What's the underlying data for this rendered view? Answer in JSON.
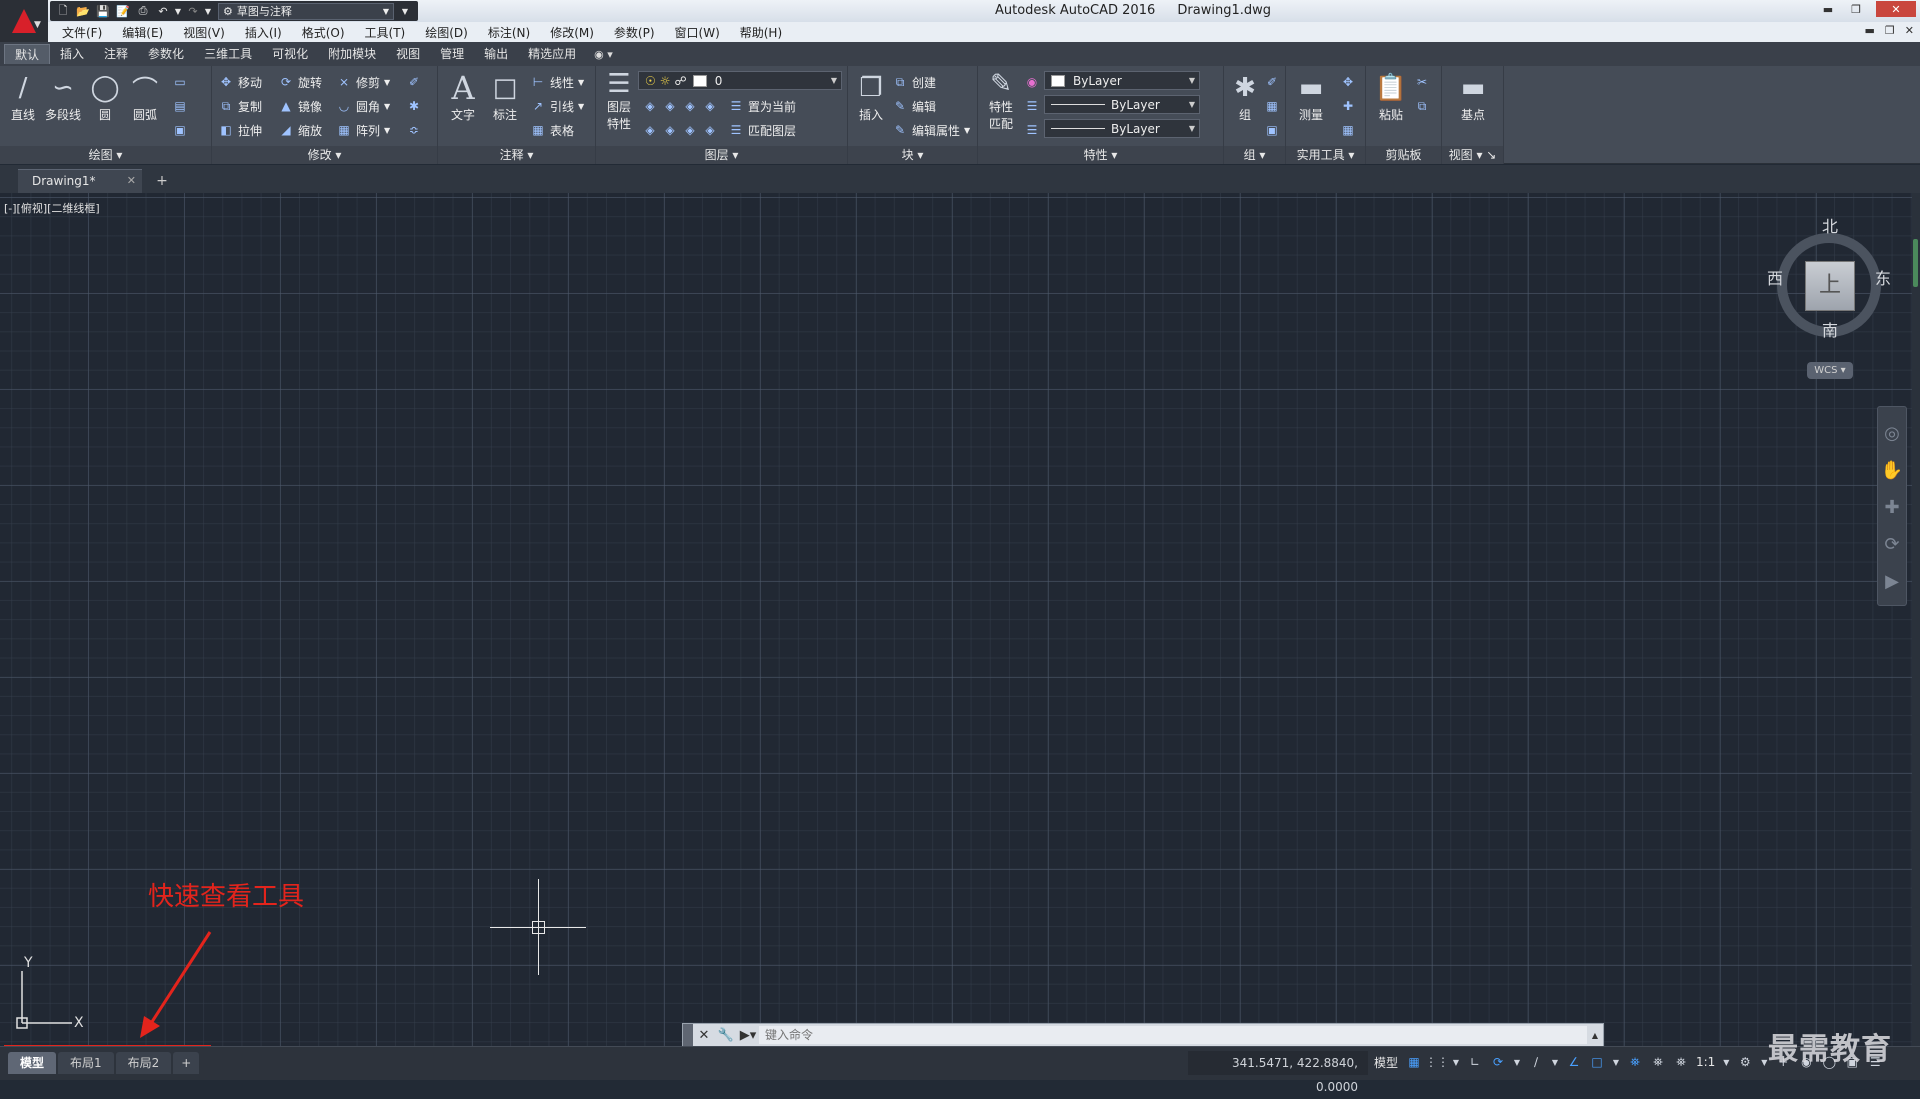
{
  "window": {
    "app_title": "Autodesk AutoCAD 2016",
    "file_title": "Drawing1.dwg"
  },
  "qat": {
    "workspace": "草图与注释"
  },
  "menu": [
    "文件(F)",
    "编辑(E)",
    "视图(V)",
    "插入(I)",
    "格式(O)",
    "工具(T)",
    "绘图(D)",
    "标注(N)",
    "修改(M)",
    "参数(P)",
    "窗口(W)",
    "帮助(H)"
  ],
  "ribbon_tabs": [
    "默认",
    "插入",
    "注释",
    "参数化",
    "三维工具",
    "可视化",
    "附加模块",
    "视图",
    "管理",
    "输出",
    "精选应用"
  ],
  "ribbon": {
    "draw": {
      "title": "绘图",
      "line": "直线",
      "polyline": "多段线",
      "circle": "圆",
      "arc": "圆弧"
    },
    "modify": {
      "title": "修改",
      "move": "移动",
      "rotate": "旋转",
      "trim": "修剪",
      "copy": "复制",
      "mirror": "镜像",
      "fillet": "圆角",
      "stretch": "拉伸",
      "scale": "缩放",
      "array": "阵列"
    },
    "annotation": {
      "title": "注释",
      "text": "文字",
      "dimension": "标注",
      "linear": "线性",
      "leader": "引线",
      "table": "表格"
    },
    "layers": {
      "title": "图层",
      "layer_props_1": "图层",
      "layer_props_2": "特性",
      "current_layer": "0",
      "set_current": "置为当前",
      "match_layer": "匹配图层"
    },
    "block": {
      "title": "块",
      "insert": "插入",
      "create": "创建",
      "edit": "编辑",
      "edit_attr": "编辑属性"
    },
    "properties": {
      "title": "特性",
      "match_1": "特性",
      "match_2": "匹配",
      "color": "ByLayer",
      "linetype": "ByLayer",
      "lineweight": "ByLayer"
    },
    "groups": {
      "title": "组",
      "group": "组"
    },
    "utilities": {
      "title": "实用工具",
      "measure": "测量"
    },
    "clipboard": {
      "title": "剪贴板",
      "paste": "粘贴"
    },
    "view": {
      "title": "视图",
      "base": "基点"
    }
  },
  "file_tab": {
    "name": "Drawing1*"
  },
  "viewport_label": "[-][俯视][二维线框]",
  "viewcube": {
    "north": "北",
    "south": "南",
    "east": "东",
    "west": "西",
    "top": "上",
    "wcs": "WCS"
  },
  "ucs": {
    "x": "X",
    "y": "Y"
  },
  "annotation": {
    "text": "快速查看工具",
    "color": "#e3241c"
  },
  "command_line": {
    "placeholder": "键入命令"
  },
  "layout_tabs": [
    "模型",
    "布局1",
    "布局2"
  ],
  "status": {
    "coords": "341.5471, 422.8840, 0.0000",
    "model": "模型",
    "scale": "1:1"
  },
  "watermark": "最需教育"
}
